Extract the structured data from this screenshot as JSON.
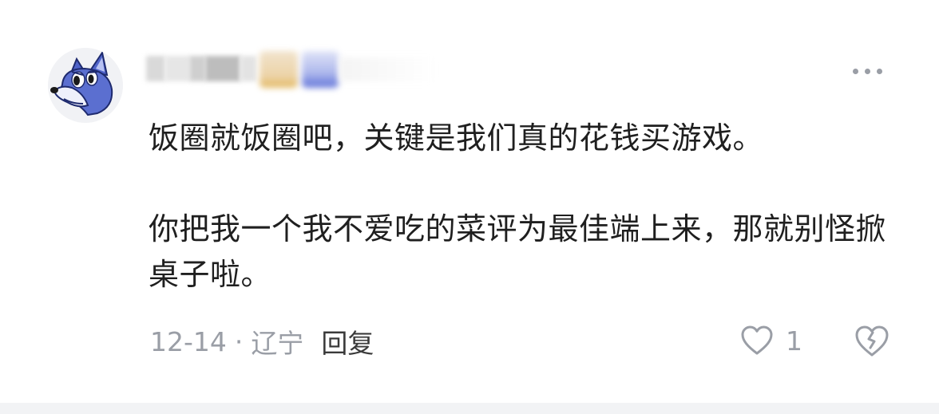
{
  "comment": {
    "paragraphs": [
      "饭圈就饭圈吧，关键是我们真的花钱买游戏。",
      "你把我一个我不爱吃的菜评为最佳端上来，那就别怪掀桌子啦。"
    ],
    "date": "12-14",
    "separator": "·",
    "location": "辽宁",
    "reply_label": "回复",
    "like_count": "1"
  },
  "icons": {
    "avatar": "blue-cartoon-dog-avatar",
    "more": "more-dots-icon",
    "like": "heart-outline-icon",
    "dislike": "broken-heart-icon"
  },
  "colors": {
    "text_primary": "#1f1f1f",
    "text_secondary": "#9a9ea6",
    "avatar_blue": "#5b6fd0",
    "background_strip": "#f2f3f5"
  }
}
